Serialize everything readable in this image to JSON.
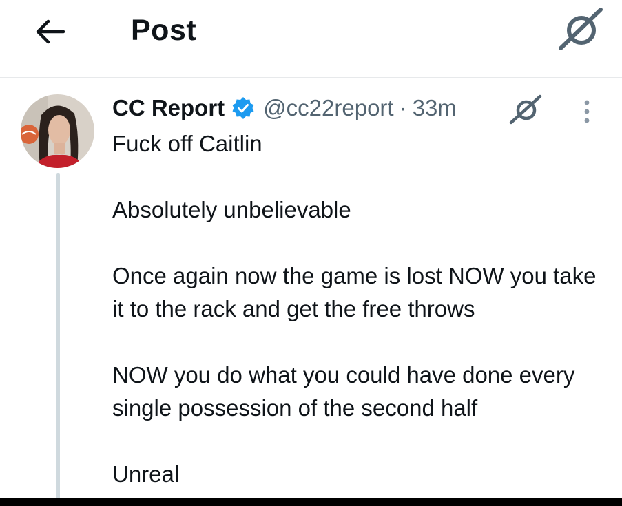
{
  "header": {
    "title": "Post",
    "back_icon": "arrow-left-icon",
    "grok_icon": "grok-icon"
  },
  "post": {
    "author": {
      "display_name": "CC Report",
      "verified": true,
      "handle": "@cc22report",
      "avatar_icon": "avatar"
    },
    "separator": "·",
    "time": "33m",
    "lines": [
      "Fuck off Caitlin",
      "",
      "Absolutely unbelievable",
      "",
      "Once again now the game is lost NOW you take it to the rack and get the free throws",
      "",
      "NOW you do what you could have done every single possession of the second half",
      "",
      "Unreal"
    ]
  },
  "colors": {
    "text": "#0f1419",
    "secondary_text": "#536471",
    "verified_blue": "#1d9bf0",
    "divider": "#e7e9eb",
    "thread_line": "#cfd9de"
  }
}
